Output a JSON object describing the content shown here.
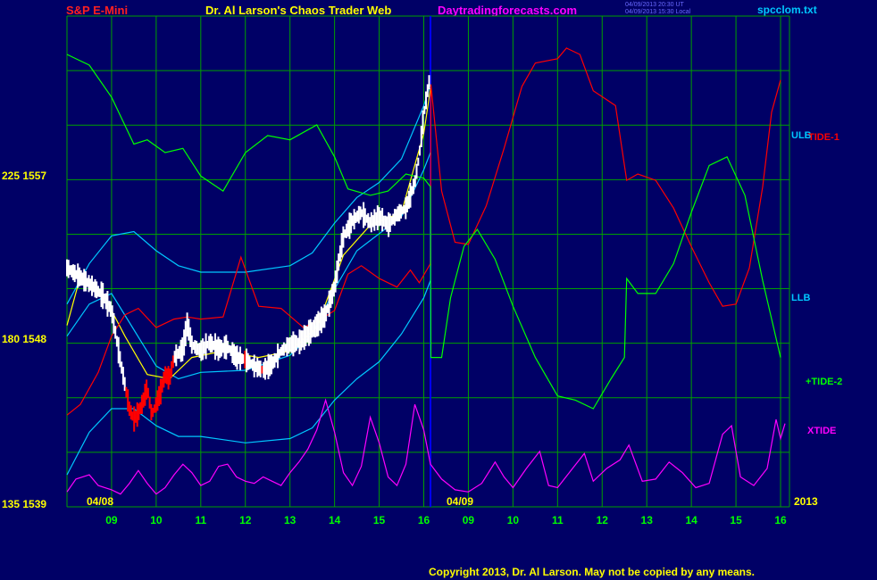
{
  "header": {
    "symbol": "S&P E-Mini",
    "title": "Dr. Al Larson's Chaos Trader Web",
    "site": "Daytradingforecasts.com",
    "file": "spcclom.txt",
    "stamp1": "04/09/2013 20:30 UT",
    "stamp2": "04/09/2013 15:30 Local"
  },
  "colors": {
    "background": "#000066",
    "grid": "#00a000",
    "price_up": "#ffffff",
    "price_down": "#ff0000",
    "tide1": "#ff0000",
    "tide2": "#00ff00",
    "xtide": "#ff00ff",
    "bands": "#00c8ff",
    "average": "#ffff00",
    "now_line": "#0000ff"
  },
  "chart_data": {
    "type": "line",
    "y_ticks": [
      "225 1557",
      "180 1548",
      "135 1539"
    ],
    "y_range": [
      1539,
      1562
    ],
    "date_labels": [
      "04/08",
      "04/09",
      "2013"
    ],
    "x_ticks": [
      "09",
      "10",
      "11",
      "12",
      "13",
      "14",
      "15",
      "16",
      "09",
      "10",
      "11",
      "12",
      "13",
      "14",
      "15",
      "16"
    ],
    "x_range": [
      8.0,
      16.5
    ],
    "now_time": 16.15,
    "series_labels": {
      "ulb": "ULB",
      "llb": "LLB",
      "tide1": "TIDE-1",
      "tide2": "+TIDE-2",
      "xtide": "XTIDE"
    },
    "price": [
      [
        8.0,
        1550.2
      ],
      [
        8.2,
        1549.9
      ],
      [
        8.4,
        1549.6
      ],
      [
        8.6,
        1549.3
      ],
      [
        8.8,
        1548.9
      ],
      [
        9.0,
        1548.2
      ],
      [
        9.1,
        1547.0
      ],
      [
        9.2,
        1545.8
      ],
      [
        9.3,
        1544.7
      ],
      [
        9.4,
        1543.6
      ],
      [
        9.5,
        1543.1
      ],
      [
        9.6,
        1543.4
      ],
      [
        9.7,
        1543.9
      ],
      [
        9.8,
        1544.6
      ],
      [
        9.9,
        1543.3
      ],
      [
        10.0,
        1543.8
      ],
      [
        10.1,
        1544.4
      ],
      [
        10.2,
        1545.2
      ],
      [
        10.3,
        1545.0
      ],
      [
        10.4,
        1546.0
      ],
      [
        10.5,
        1546.2
      ],
      [
        10.6,
        1546.4
      ],
      [
        10.7,
        1547.6
      ],
      [
        10.8,
        1546.6
      ],
      [
        11.0,
        1546.3
      ],
      [
        11.2,
        1546.7
      ],
      [
        11.4,
        1546.4
      ],
      [
        11.6,
        1546.5
      ],
      [
        11.8,
        1546.0
      ],
      [
        12.0,
        1545.9
      ],
      [
        12.2,
        1545.6
      ],
      [
        12.4,
        1545.4
      ],
      [
        12.6,
        1545.7
      ],
      [
        12.8,
        1546.3
      ],
      [
        13.0,
        1546.6
      ],
      [
        13.2,
        1546.7
      ],
      [
        13.4,
        1547.1
      ],
      [
        13.6,
        1547.5
      ],
      [
        13.8,
        1548.0
      ],
      [
        14.0,
        1549.3
      ],
      [
        14.1,
        1550.6
      ],
      [
        14.2,
        1551.7
      ],
      [
        14.4,
        1552.4
      ],
      [
        14.6,
        1552.8
      ],
      [
        14.8,
        1552.3
      ],
      [
        15.0,
        1552.6
      ],
      [
        15.2,
        1552.2
      ],
      [
        15.4,
        1552.7
      ],
      [
        15.6,
        1553.0
      ],
      [
        15.8,
        1554.2
      ],
      [
        15.9,
        1555.5
      ],
      [
        16.0,
        1557.4
      ],
      [
        16.1,
        1558.7
      ],
      [
        16.15,
        1559.2
      ]
    ],
    "upper_band": [
      [
        8.0,
        1548.5
      ],
      [
        8.5,
        1550.4
      ],
      [
        9.0,
        1551.7
      ],
      [
        9.5,
        1551.9
      ],
      [
        10.0,
        1551.0
      ],
      [
        10.5,
        1550.3
      ],
      [
        11.0,
        1550.0
      ],
      [
        12.0,
        1550.0
      ],
      [
        13.0,
        1550.3
      ],
      [
        13.5,
        1550.9
      ],
      [
        14.0,
        1552.3
      ],
      [
        14.5,
        1553.5
      ],
      [
        15.0,
        1554.2
      ],
      [
        15.5,
        1555.3
      ],
      [
        16.0,
        1557.8
      ],
      [
        16.15,
        1558.8
      ]
    ],
    "lower_band": [
      [
        8.0,
        1540.5
      ],
      [
        8.5,
        1542.5
      ],
      [
        9.0,
        1543.6
      ],
      [
        9.5,
        1543.6
      ],
      [
        10.0,
        1542.8
      ],
      [
        10.5,
        1542.3
      ],
      [
        11.0,
        1542.3
      ],
      [
        12.0,
        1542.0
      ],
      [
        13.0,
        1542.2
      ],
      [
        13.5,
        1542.7
      ],
      [
        14.0,
        1544.0
      ],
      [
        14.5,
        1545.0
      ],
      [
        15.0,
        1545.8
      ],
      [
        15.5,
        1547.1
      ],
      [
        16.0,
        1548.8
      ],
      [
        16.15,
        1549.6
      ]
    ],
    "inner_band_upper": [
      [
        8.0,
        1547.0
      ],
      [
        8.5,
        1548.5
      ],
      [
        9.0,
        1549.0
      ],
      [
        9.5,
        1547.3
      ],
      [
        10.0,
        1545.6
      ],
      [
        10.5,
        1545.0
      ],
      [
        11.0,
        1545.3
      ],
      [
        12.0,
        1545.4
      ],
      [
        13.0,
        1546.1
      ],
      [
        13.5,
        1547.1
      ],
      [
        14.0,
        1549.2
      ],
      [
        14.5,
        1551.0
      ],
      [
        15.0,
        1551.8
      ],
      [
        15.5,
        1552.6
      ],
      [
        16.0,
        1554.8
      ],
      [
        16.15,
        1555.6
      ]
    ],
    "moving_average": [
      [
        8.0,
        1547.5
      ],
      [
        8.3,
        1549.8
      ],
      [
        8.8,
        1549.0
      ],
      [
        9.3,
        1547.0
      ],
      [
        9.8,
        1545.2
      ],
      [
        10.3,
        1545.0
      ],
      [
        10.8,
        1546.0
      ],
      [
        11.5,
        1546.3
      ],
      [
        12.3,
        1546.0
      ],
      [
        13.0,
        1546.3
      ],
      [
        13.6,
        1547.4
      ],
      [
        14.2,
        1550.8
      ],
      [
        14.8,
        1552.2
      ],
      [
        15.5,
        1552.8
      ],
      [
        16.0,
        1556.5
      ],
      [
        16.15,
        1558.6
      ]
    ],
    "tide1": [
      [
        8.0,
        1543.3
      ],
      [
        8.3,
        1543.8
      ],
      [
        8.7,
        1545.3
      ],
      [
        9.0,
        1547.0
      ],
      [
        9.3,
        1548.0
      ],
      [
        9.6,
        1548.3
      ],
      [
        10.0,
        1547.4
      ],
      [
        10.4,
        1547.8
      ],
      [
        10.7,
        1547.9
      ],
      [
        11.0,
        1547.8
      ],
      [
        11.5,
        1547.9
      ],
      [
        11.9,
        1550.7
      ],
      [
        12.3,
        1548.4
      ],
      [
        12.8,
        1548.3
      ],
      [
        13.3,
        1547.4
      ],
      [
        13.7,
        1547.8
      ],
      [
        14.0,
        1548.2
      ],
      [
        14.3,
        1549.9
      ],
      [
        14.6,
        1550.3
      ],
      [
        15.0,
        1549.7
      ],
      [
        15.4,
        1549.3
      ],
      [
        15.7,
        1550.1
      ],
      [
        15.9,
        1549.5
      ],
      [
        16.15,
        1550.4
      ],
      [
        16.16,
        1558.8
      ],
      [
        16.4,
        1553.8
      ],
      [
        16.7,
        1551.4
      ],
      [
        17.0,
        1551.3
      ],
      [
        17.4,
        1553.1
      ],
      [
        17.8,
        1555.8
      ],
      [
        18.2,
        1558.7
      ],
      [
        18.5,
        1559.8
      ],
      [
        19.0,
        1560.0
      ],
      [
        19.2,
        1560.5
      ],
      [
        19.5,
        1560.2
      ],
      [
        19.8,
        1558.5
      ],
      [
        20.3,
        1557.8
      ],
      [
        20.55,
        1554.3
      ],
      [
        20.8,
        1554.6
      ],
      [
        21.2,
        1554.3
      ],
      [
        21.6,
        1553.0
      ],
      [
        22.0,
        1551.2
      ],
      [
        22.4,
        1549.5
      ],
      [
        22.7,
        1548.4
      ],
      [
        23.0,
        1548.5
      ],
      [
        23.3,
        1550.2
      ],
      [
        23.6,
        1554.0
      ],
      [
        23.8,
        1557.5
      ],
      [
        24.0,
        1559.0
      ]
    ],
    "tide2": [
      [
        8.0,
        1560.2
      ],
      [
        8.5,
        1559.7
      ],
      [
        9.0,
        1558.2
      ],
      [
        9.5,
        1556.0
      ],
      [
        9.8,
        1556.2
      ],
      [
        10.2,
        1555.6
      ],
      [
        10.6,
        1555.8
      ],
      [
        11.0,
        1554.5
      ],
      [
        11.5,
        1553.8
      ],
      [
        12.0,
        1555.6
      ],
      [
        12.5,
        1556.4
      ],
      [
        13.0,
        1556.2
      ],
      [
        13.6,
        1556.9
      ],
      [
        14.0,
        1555.4
      ],
      [
        14.3,
        1553.9
      ],
      [
        14.8,
        1553.6
      ],
      [
        15.2,
        1553.8
      ],
      [
        15.6,
        1554.6
      ],
      [
        16.0,
        1554.4
      ],
      [
        16.15,
        1554.0
      ],
      [
        16.16,
        1546.0
      ],
      [
        16.4,
        1546.0
      ],
      [
        16.6,
        1548.8
      ],
      [
        16.9,
        1551.2
      ],
      [
        17.2,
        1552.0
      ],
      [
        17.6,
        1550.6
      ],
      [
        18.0,
        1548.4
      ],
      [
        18.5,
        1546.0
      ],
      [
        19.0,
        1544.2
      ],
      [
        19.4,
        1544.0
      ],
      [
        19.8,
        1543.6
      ],
      [
        20.2,
        1545.0
      ],
      [
        20.5,
        1546.0
      ],
      [
        20.55,
        1549.7
      ],
      [
        20.8,
        1549.0
      ],
      [
        21.2,
        1549.0
      ],
      [
        21.6,
        1550.4
      ],
      [
        22.0,
        1552.8
      ],
      [
        22.4,
        1555.0
      ],
      [
        22.8,
        1555.4
      ],
      [
        23.2,
        1553.6
      ],
      [
        23.6,
        1549.6
      ],
      [
        24.0,
        1546.0
      ]
    ],
    "xtide": [
      [
        8.0,
        1539.7
      ],
      [
        8.2,
        1540.3
      ],
      [
        8.5,
        1540.5
      ],
      [
        8.7,
        1540.0
      ],
      [
        9.0,
        1539.8
      ],
      [
        9.2,
        1539.6
      ],
      [
        9.4,
        1540.1
      ],
      [
        9.6,
        1540.7
      ],
      [
        9.8,
        1540.1
      ],
      [
        10.0,
        1539.6
      ],
      [
        10.2,
        1539.9
      ],
      [
        10.4,
        1540.5
      ],
      [
        10.6,
        1541.0
      ],
      [
        10.8,
        1540.6
      ],
      [
        11.0,
        1540.0
      ],
      [
        11.2,
        1540.2
      ],
      [
        11.4,
        1540.9
      ],
      [
        11.6,
        1541.0
      ],
      [
        11.8,
        1540.4
      ],
      [
        12.0,
        1540.2
      ],
      [
        12.2,
        1540.1
      ],
      [
        12.4,
        1540.4
      ],
      [
        12.6,
        1540.2
      ],
      [
        12.8,
        1540.0
      ],
      [
        13.0,
        1540.6
      ],
      [
        13.2,
        1541.1
      ],
      [
        13.4,
        1541.7
      ],
      [
        13.6,
        1542.6
      ],
      [
        13.8,
        1544.0
      ],
      [
        14.0,
        1542.5
      ],
      [
        14.2,
        1540.6
      ],
      [
        14.4,
        1540.0
      ],
      [
        14.6,
        1540.9
      ],
      [
        14.8,
        1543.2
      ],
      [
        15.0,
        1542.0
      ],
      [
        15.2,
        1540.4
      ],
      [
        15.4,
        1540.0
      ],
      [
        15.6,
        1541.0
      ],
      [
        15.8,
        1543.8
      ],
      [
        16.0,
        1542.6
      ],
      [
        16.15,
        1541.0
      ],
      [
        16.4,
        1540.3
      ],
      [
        16.7,
        1539.8
      ],
      [
        17.0,
        1539.7
      ],
      [
        17.3,
        1540.1
      ],
      [
        17.6,
        1541.1
      ],
      [
        17.8,
        1540.4
      ],
      [
        18.0,
        1539.9
      ],
      [
        18.3,
        1540.8
      ],
      [
        18.6,
        1541.6
      ],
      [
        18.8,
        1540.0
      ],
      [
        19.0,
        1539.9
      ],
      [
        19.3,
        1540.7
      ],
      [
        19.6,
        1541.5
      ],
      [
        19.8,
        1540.2
      ],
      [
        20.1,
        1540.8
      ],
      [
        20.4,
        1541.2
      ],
      [
        20.6,
        1541.9
      ],
      [
        20.9,
        1540.2
      ],
      [
        21.2,
        1540.3
      ],
      [
        21.5,
        1541.1
      ],
      [
        21.8,
        1540.6
      ],
      [
        22.1,
        1539.9
      ],
      [
        22.4,
        1540.1
      ],
      [
        22.7,
        1542.4
      ],
      [
        22.9,
        1542.8
      ],
      [
        23.1,
        1540.4
      ],
      [
        23.4,
        1540.0
      ],
      [
        23.7,
        1540.8
      ],
      [
        23.9,
        1543.1
      ],
      [
        24.0,
        1542.2
      ],
      [
        24.1,
        1542.9
      ]
    ]
  }
}
